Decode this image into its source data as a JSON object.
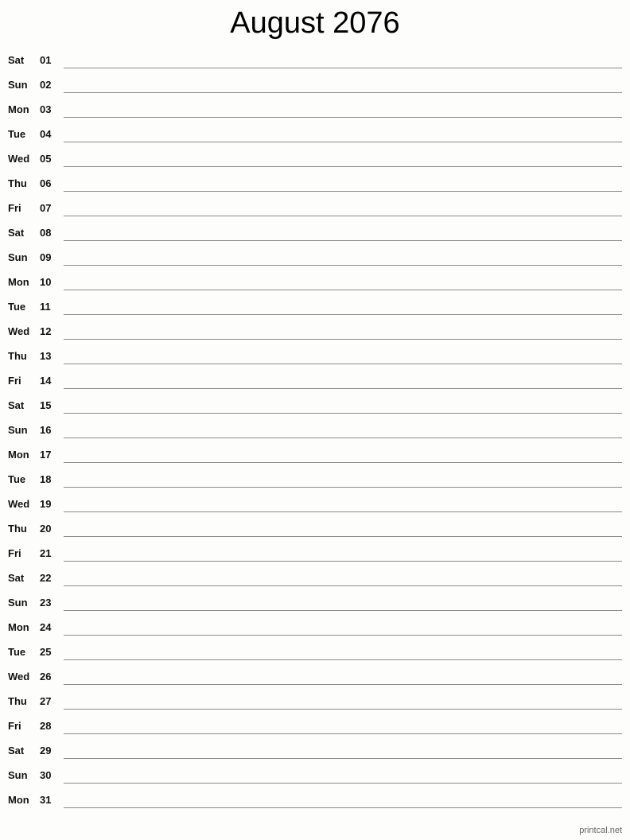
{
  "title": "August 2076",
  "days": [
    {
      "dow": "Sat",
      "day": "01"
    },
    {
      "dow": "Sun",
      "day": "02"
    },
    {
      "dow": "Mon",
      "day": "03"
    },
    {
      "dow": "Tue",
      "day": "04"
    },
    {
      "dow": "Wed",
      "day": "05"
    },
    {
      "dow": "Thu",
      "day": "06"
    },
    {
      "dow": "Fri",
      "day": "07"
    },
    {
      "dow": "Sat",
      "day": "08"
    },
    {
      "dow": "Sun",
      "day": "09"
    },
    {
      "dow": "Mon",
      "day": "10"
    },
    {
      "dow": "Tue",
      "day": "11"
    },
    {
      "dow": "Wed",
      "day": "12"
    },
    {
      "dow": "Thu",
      "day": "13"
    },
    {
      "dow": "Fri",
      "day": "14"
    },
    {
      "dow": "Sat",
      "day": "15"
    },
    {
      "dow": "Sun",
      "day": "16"
    },
    {
      "dow": "Mon",
      "day": "17"
    },
    {
      "dow": "Tue",
      "day": "18"
    },
    {
      "dow": "Wed",
      "day": "19"
    },
    {
      "dow": "Thu",
      "day": "20"
    },
    {
      "dow": "Fri",
      "day": "21"
    },
    {
      "dow": "Sat",
      "day": "22"
    },
    {
      "dow": "Sun",
      "day": "23"
    },
    {
      "dow": "Mon",
      "day": "24"
    },
    {
      "dow": "Tue",
      "day": "25"
    },
    {
      "dow": "Wed",
      "day": "26"
    },
    {
      "dow": "Thu",
      "day": "27"
    },
    {
      "dow": "Fri",
      "day": "28"
    },
    {
      "dow": "Sat",
      "day": "29"
    },
    {
      "dow": "Sun",
      "day": "30"
    },
    {
      "dow": "Mon",
      "day": "31"
    }
  ],
  "footer": "printcal.net"
}
